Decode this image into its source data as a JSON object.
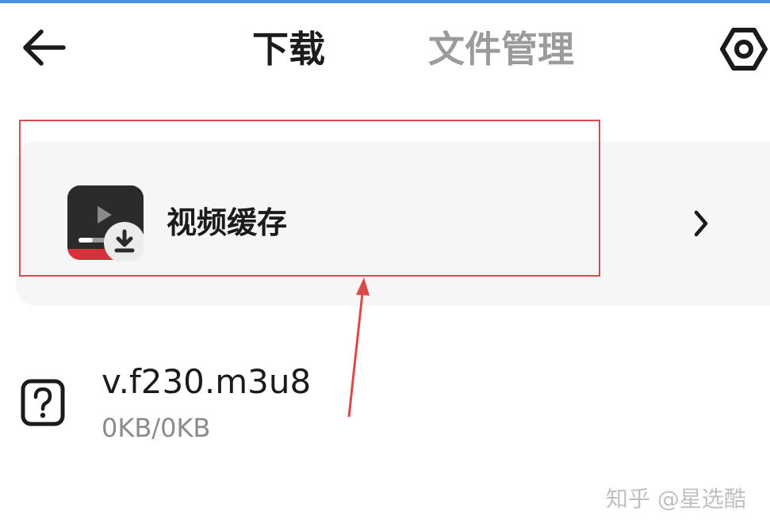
{
  "header": {
    "tabs": [
      {
        "label": "下载",
        "active": true
      },
      {
        "label": "文件管理",
        "active": false
      }
    ],
    "back_icon": "arrow-left-icon",
    "settings_icon": "gear-icon"
  },
  "cache_card": {
    "label": "视频缓存",
    "icon": "video-cache-icon",
    "chevron_icon": "chevron-right-icon"
  },
  "files": [
    {
      "name": "v.f230.m3u8",
      "size": "0KB/0KB",
      "icon": "question-file-icon"
    }
  ],
  "watermark": "知乎 @星选酷",
  "colors": {
    "accent_strip": "#4a90e2",
    "annotation_red": "#d94a4a",
    "active_tab": "#1b1b1b",
    "inactive_tab": "#9b9b9b",
    "card_bg": "#f6f6f6"
  }
}
